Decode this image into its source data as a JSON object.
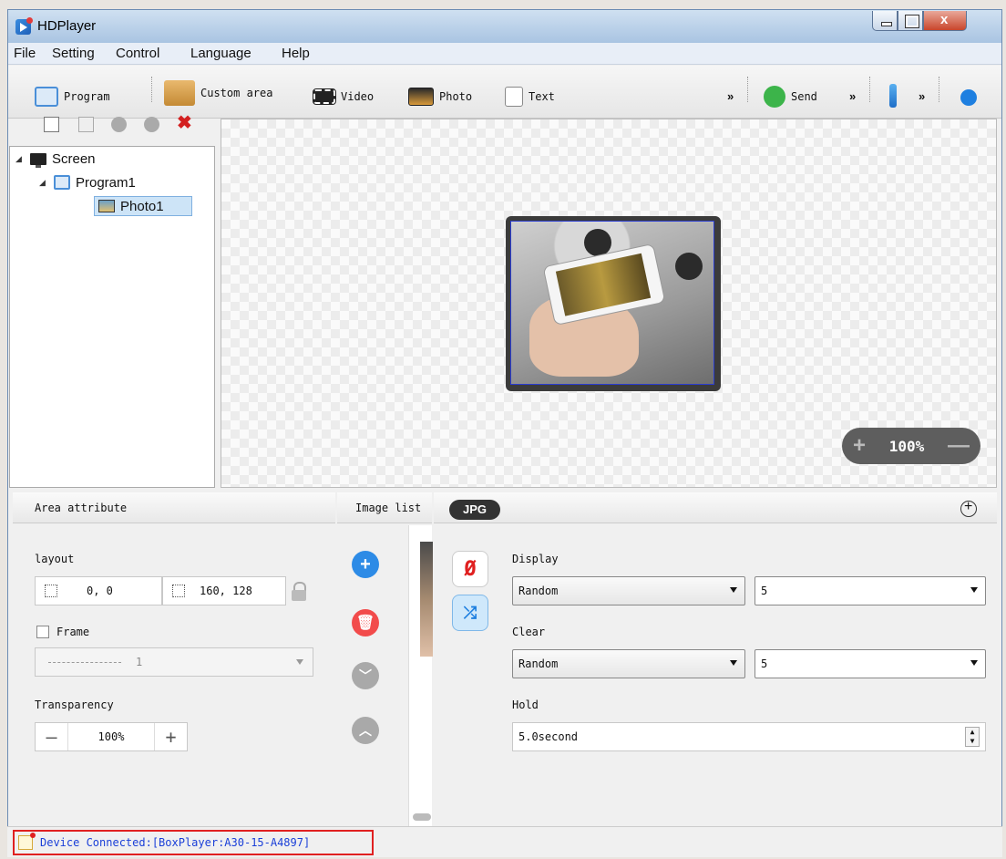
{
  "window": {
    "title": "HDPlayer"
  },
  "menu": [
    "File",
    "Setting",
    "Control",
    "Language",
    "Help"
  ],
  "toolbar": {
    "program": "Program",
    "custom_area": "Custom area",
    "video": "Video",
    "photo": "Photo",
    "text": "Text",
    "more1": "»",
    "send": "Send",
    "more2": "»",
    "more3": "»"
  },
  "tree": {
    "screen": "Screen",
    "program": "Program1",
    "photo": "Photo1"
  },
  "canvas": {
    "zoom": "100%",
    "zoom_in": "+",
    "zoom_out": "—"
  },
  "area_attribute": {
    "header": "Area attribute",
    "layout_label": "layout",
    "position": "0, 0",
    "size": "160, 128",
    "frame_label": "Frame",
    "frame_value": "1",
    "transparency_label": "Transparency",
    "transparency_value": "100%"
  },
  "image_list": {
    "header": "Image list",
    "format_tag": "JPG"
  },
  "effect": {
    "display_label": "Display",
    "display_effect": "Random",
    "display_speed": "5",
    "clear_label": "Clear",
    "clear_effect": "Random",
    "clear_speed": "5",
    "hold_label": "Hold",
    "hold_value": "5.0second"
  },
  "status": {
    "text": "Device Connected:[BoxPlayer:A30-15-A4897]"
  },
  "colors": {
    "accent_blue": "#2d8be6",
    "delete_red": "#f24b4b",
    "status_text": "#1a3fd8",
    "highlight_border": "#e02020"
  }
}
